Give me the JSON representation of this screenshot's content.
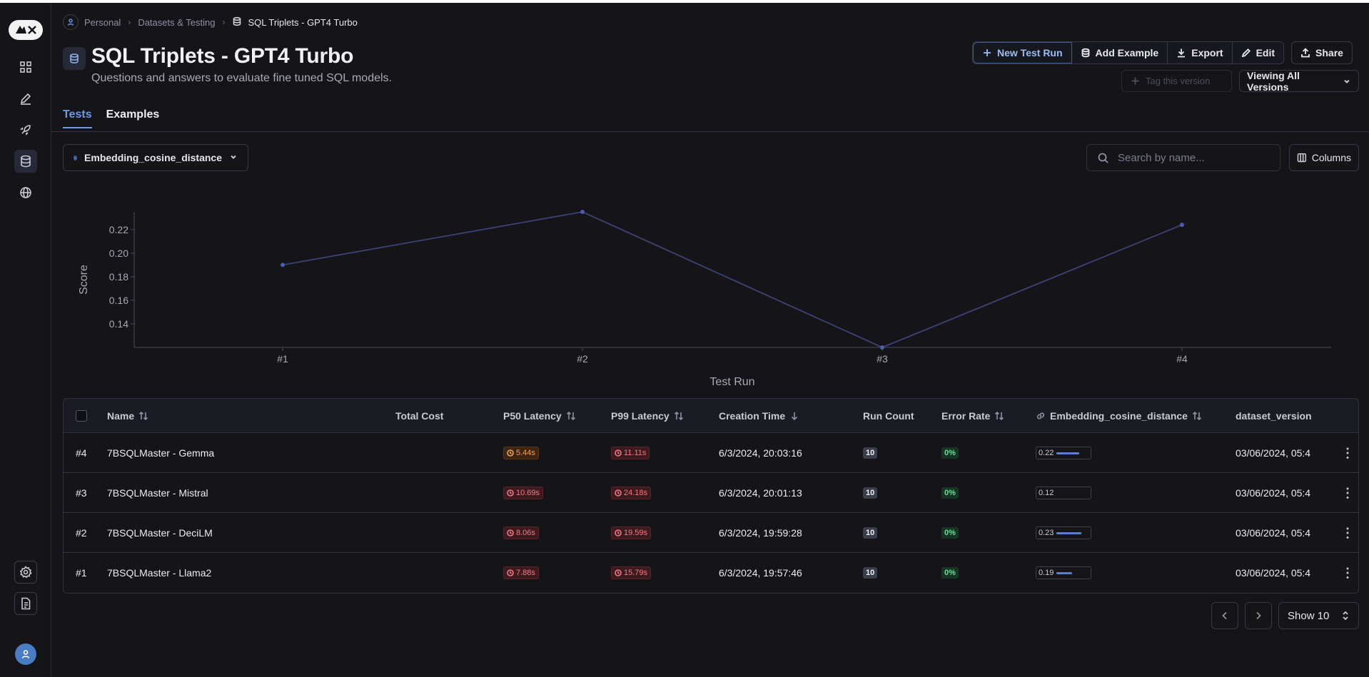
{
  "breadcrumb": {
    "items": [
      "Personal",
      "Datasets & Testing",
      "SQL Triplets - GPT4 Turbo"
    ]
  },
  "header": {
    "title": "SQL Triplets - GPT4 Turbo",
    "subtitle": "Questions and answers to evaluate fine tuned SQL models."
  },
  "actions": {
    "new_test_run": "New Test Run",
    "add_example": "Add Example",
    "export": "Export",
    "edit": "Edit",
    "share": "Share",
    "tag_version": "Tag this version",
    "version_select": "Viewing All Versions"
  },
  "tabs": [
    {
      "label": "Tests",
      "active": true
    },
    {
      "label": "Examples",
      "active": false
    }
  ],
  "metric_select": {
    "value": "Embedding_cosine_distance"
  },
  "search": {
    "placeholder": "Search by name..."
  },
  "columns_button": "Columns",
  "chart_data": {
    "type": "line",
    "categories": [
      "#1",
      "#2",
      "#3",
      "#4"
    ],
    "values": [
      0.19,
      0.235,
      0.12,
      0.224
    ],
    "xlabel": "Test Run",
    "ylabel": "Score",
    "yticks": [
      "0.14",
      "0.16",
      "0.18",
      "0.20",
      "0.22"
    ],
    "ylim": [
      0.12,
      0.235
    ],
    "color": "#3d4275"
  },
  "table": {
    "headers": {
      "name": "Name",
      "total_cost": "Total Cost",
      "p50": "P50 Latency",
      "p99": "P99 Latency",
      "creation_time": "Creation Time",
      "run_count": "Run Count",
      "error_rate": "Error Rate",
      "metric": "Embedding_cosine_distance",
      "dataset_version": "dataset_version"
    },
    "rows": [
      {
        "id": "#4",
        "name": "7BSQLMaster - Gemma",
        "total_cost": "",
        "p50": "5.44s",
        "p50_status": "orange",
        "p99": "11.11s",
        "created": "6/3/2024, 20:03:16",
        "run_count": "10",
        "error_rate": "0%",
        "score": "0.22",
        "score_fill": 0.67,
        "dataset_version": "03/06/2024, 05:4"
      },
      {
        "id": "#3",
        "name": "7BSQLMaster - Mistral",
        "total_cost": "",
        "p50": "10.69s",
        "p50_status": "red",
        "p99": "24.18s",
        "created": "6/3/2024, 20:01:13",
        "run_count": "10",
        "error_rate": "0%",
        "score": "0.12",
        "score_fill": 0.0,
        "dataset_version": "03/06/2024, 05:4"
      },
      {
        "id": "#2",
        "name": "7BSQLMaster - DeciLM",
        "total_cost": "",
        "p50": "8.06s",
        "p50_status": "red",
        "p99": "19.59s",
        "created": "6/3/2024, 19:59:28",
        "run_count": "10",
        "error_rate": "0%",
        "score": "0.23",
        "score_fill": 0.72,
        "dataset_version": "03/06/2024, 05:4"
      },
      {
        "id": "#1",
        "name": "7BSQLMaster - Llama2",
        "total_cost": "",
        "p50": "7.88s",
        "p50_status": "red",
        "p99": "15.79s",
        "created": "6/3/2024, 19:57:46",
        "run_count": "10",
        "error_rate": "0%",
        "score": "0.19",
        "score_fill": 0.45,
        "dataset_version": "03/06/2024, 05:4"
      }
    ]
  },
  "pagination": {
    "show": "Show 10"
  },
  "colors": {
    "background": "#141419",
    "accent": "#6f9be6",
    "chart_line": "#3d4275"
  }
}
